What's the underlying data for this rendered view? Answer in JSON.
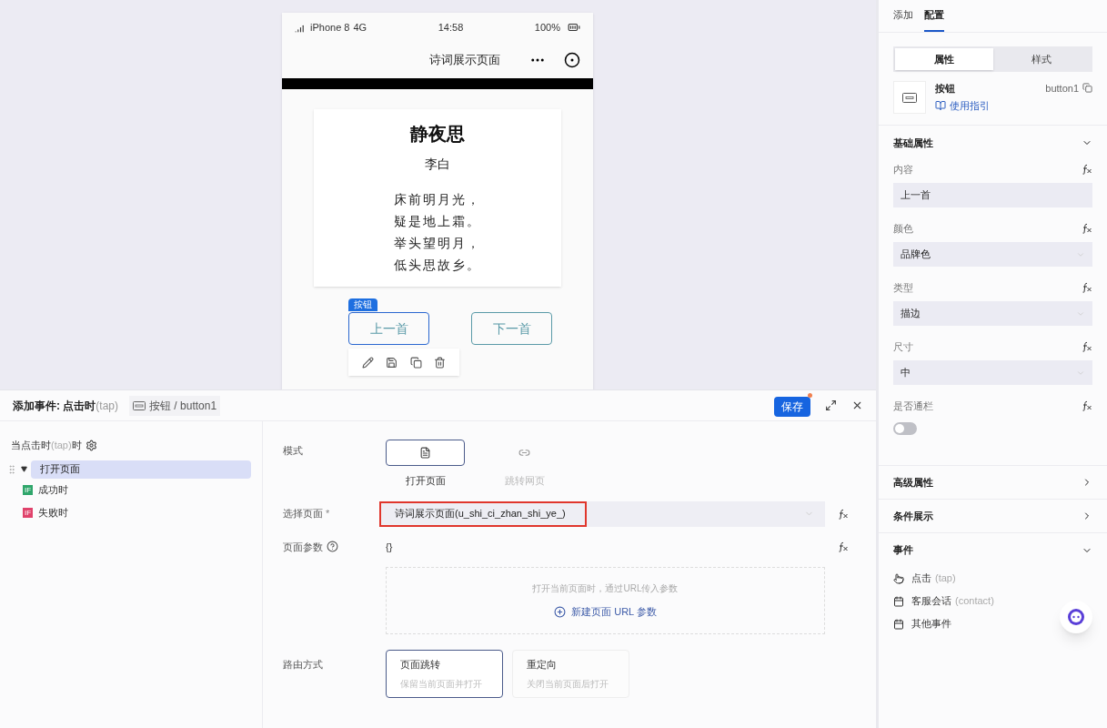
{
  "phone": {
    "status": {
      "carrier": "iPhone 8",
      "network": "4G",
      "time": "14:58",
      "battery": "100%"
    },
    "title": "诗词展示页面",
    "poem": {
      "title": "静夜思",
      "author": "李白",
      "lines": [
        "床前明月光，",
        "疑是地上霜。",
        "举头望明月，",
        "低头思故乡。"
      ]
    },
    "selection_tag": "按钮",
    "buttons": [
      {
        "label": "上一首",
        "selected": true
      },
      {
        "label": "下一首",
        "selected": false
      }
    ]
  },
  "event_panel": {
    "title": "添加事件: 点击时",
    "title_hint": "(tap)",
    "component": "按钮 / button1",
    "save": "保存",
    "unsaved": true,
    "trigger": {
      "label": "当点击时",
      "hint": "(tap)",
      "suffix": "时"
    },
    "tree": [
      {
        "label": "打开页面",
        "expanded": true,
        "selected": true,
        "children": [
          {
            "badge": "IF",
            "label": "成功时",
            "color": "#2fa66b"
          },
          {
            "badge": "IF",
            "label": "失败时",
            "color": "#e0426b"
          }
        ]
      }
    ],
    "mode": {
      "label": "模式",
      "options": [
        {
          "label": "打开页面",
          "kind": "page",
          "selected": true
        },
        {
          "label": "跳转网页",
          "kind": "link",
          "selected": false
        }
      ]
    },
    "page_select": {
      "label": "选择页面",
      "required": "*",
      "value": "诗词展示页面(u_shi_ci_zhan_shi_ye_)"
    },
    "params": {
      "label": "页面参数",
      "value": "{}",
      "hint": "打开当前页面时，通过URL传入参数",
      "add_label": "新建页面 URL 参数"
    },
    "route": {
      "label": "路由方式",
      "options": [
        {
          "title": "页面跳转",
          "desc": "保留当前页面并打开",
          "selected": true
        },
        {
          "title": "重定向",
          "desc": "关闭当前页面后打开",
          "selected": false
        }
      ]
    }
  },
  "inspector": {
    "tabs": [
      {
        "label": "添加",
        "selected": false
      },
      {
        "label": "配置",
        "selected": true
      }
    ],
    "segments": [
      {
        "label": "属性",
        "selected": true
      },
      {
        "label": "样式",
        "selected": false
      }
    ],
    "component": {
      "name": "按钮",
      "id": "button1",
      "guide": "使用指引"
    },
    "basic": {
      "title": "基础属性",
      "expanded": true,
      "fields": [
        {
          "kind": "input",
          "label": "内容",
          "value": "上一首"
        },
        {
          "kind": "select",
          "label": "颜色",
          "value": "品牌色"
        },
        {
          "kind": "select",
          "label": "类型",
          "value": "描边"
        },
        {
          "kind": "select",
          "label": "尺寸",
          "value": "中"
        },
        {
          "kind": "switch",
          "label": "是否通栏",
          "on": false
        }
      ]
    },
    "sections": [
      {
        "title": "高级属性",
        "expanded": false
      },
      {
        "title": "条件展示",
        "expanded": false
      }
    ],
    "events": {
      "title": "事件",
      "expanded": true,
      "items": [
        {
          "kind": "tap",
          "label": "点击",
          "hint": "(tap)"
        },
        {
          "kind": "form",
          "label": "客服会话",
          "hint": "(contact)"
        },
        {
          "kind": "form",
          "label": "其他事件"
        }
      ]
    }
  }
}
